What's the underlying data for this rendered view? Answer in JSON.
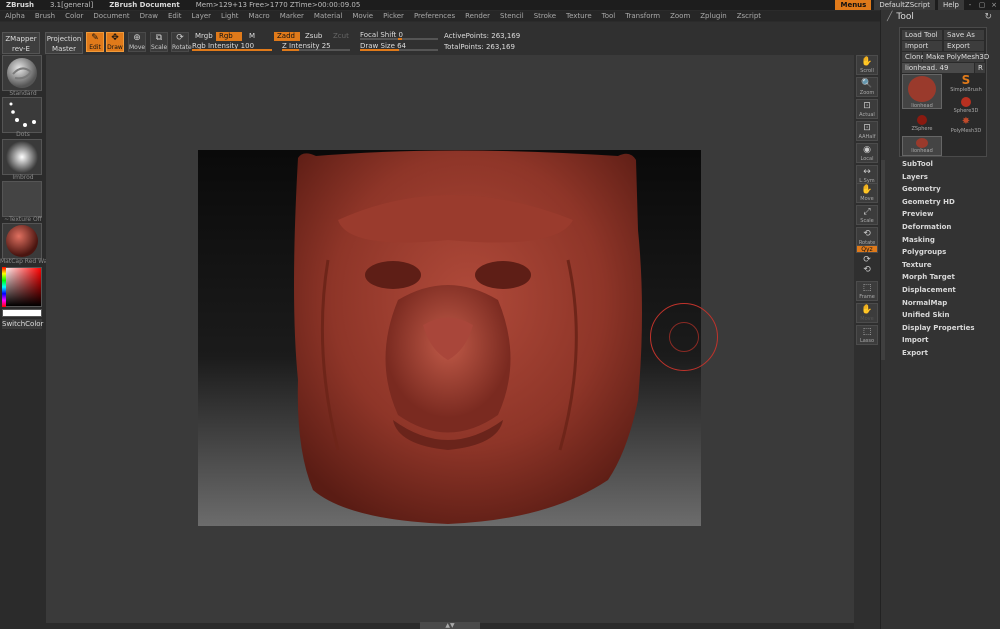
{
  "titlebar": {
    "app": "ZBrush",
    "version": "3.1[general]",
    "document": "ZBrush Document",
    "mem": "Mem>129+13  Free>1770  ZTime>00:00:09.05",
    "menus_btn": "Menus",
    "script_btn": "DefaultZScript",
    "help_btn": "Help",
    "controls": [
      "-",
      "▢",
      "×"
    ]
  },
  "menubar": [
    "Alpha",
    "Brush",
    "Color",
    "Document",
    "Draw",
    "Edit",
    "Layer",
    "Light",
    "Macro",
    "Marker",
    "Material",
    "Movie",
    "Picker",
    "Preferences",
    "Render",
    "Stencil",
    "Stroke",
    "Texture",
    "Tool",
    "Transform",
    "Zoom",
    "Zplugin",
    "Zscript"
  ],
  "toolbar": {
    "zmapper": "ZMapper",
    "zmapper_sub": "rev-E",
    "projection": "Projection",
    "projection_sub": "Master",
    "modes": [
      {
        "label": "Edit",
        "glyph": "✎",
        "active": true
      },
      {
        "label": "Draw",
        "glyph": "✥",
        "active": true
      },
      {
        "label": "Move",
        "glyph": "⊕",
        "active": false
      },
      {
        "label": "Scale",
        "glyph": "⧉",
        "active": false
      },
      {
        "label": "Rotate",
        "glyph": "⟳",
        "active": false
      }
    ],
    "mrgb": "Mrgb",
    "rgb": "Rgb",
    "m": "M",
    "rgb_intensity": "Rgb Intensity 100",
    "rgb_intensity_value": 100,
    "zadd": "Zadd",
    "zsub": "Zsub",
    "zcut": "Zcut",
    "z_intensity": "Z Intensity 25",
    "z_intensity_value": 25,
    "focal_shift": "Focal Shift 0",
    "focal_shift_value": 0,
    "draw_size": "Draw Size 64",
    "draw_size_value": 64,
    "active_points": "ActivePoints: 263,169",
    "total_points": "TotalPoints: 263,169"
  },
  "leftshelf": {
    "standard": "Standard",
    "dots": "Dots",
    "alpha": "Imbrod",
    "texture": "~Texture Off",
    "material": "MatCap Red Wax",
    "switch_color": "SwitchColor"
  },
  "rightshelf": [
    {
      "label": "Scroll",
      "glyph": "✋"
    },
    {
      "label": "Zoom",
      "glyph": "🔍"
    },
    {
      "label": "Actual",
      "glyph": "⊡"
    },
    {
      "label": "AAHalf",
      "glyph": "⊡"
    },
    {
      "label": "Local",
      "glyph": "◉"
    },
    {
      "label": "L.Sym",
      "glyph": "↔"
    },
    {
      "label": "Move",
      "glyph": "✋"
    },
    {
      "label": "Scale",
      "glyph": "⤢"
    },
    {
      "label": "Rotate",
      "glyph": "⟲"
    },
    {
      "label": "Qyz",
      "glyph": ""
    },
    {
      "label": "",
      "glyph": "⟳"
    },
    {
      "label": "",
      "glyph": "⟲"
    },
    {
      "label": "Frame",
      "glyph": "⬚"
    },
    {
      "label": "Move",
      "glyph": "✋"
    },
    {
      "label": "Lasso",
      "glyph": "⬚"
    }
  ],
  "tray": {
    "title": "Tool",
    "load_tool": "Load Tool",
    "save_as": "Save As",
    "import": "Import",
    "export": "Export",
    "clone": "Clone",
    "make_polymesh": "Make PolyMesh3D",
    "tool_name": "lionhead. 49",
    "r": "R",
    "thumbs": [
      "lionhead",
      "SimpleBrush",
      "Sphere3D",
      "ZSphere",
      "PolyMesh3D",
      "lionhead"
    ],
    "items": [
      "SubTool",
      "Layers",
      "Geometry",
      "Geometry HD",
      "Preview",
      "Deformation",
      "Masking",
      "Polygroups",
      "Texture",
      "Morph Target",
      "Displacement",
      "NormalMap",
      "Unified Skin",
      "Display Properties",
      "Import",
      "Export"
    ]
  },
  "bottom_tab": "▲▼",
  "colors": {
    "accent": "#e07a1a",
    "cursor": "#c0332b",
    "clay": "#9a3a2c"
  }
}
